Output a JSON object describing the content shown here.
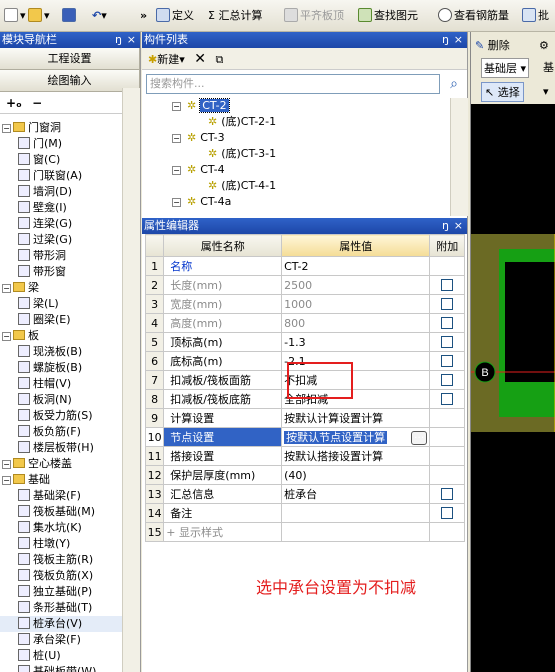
{
  "toolbar": {
    "define": "定义",
    "sum_calc": "Σ 汇总计算",
    "flat_top": "平齐板顶",
    "find_elem": "查找图元",
    "view_rebar": "查看钢筋量",
    "batch": "批"
  },
  "nav": {
    "title": "模块导航栏",
    "pin": "ŋ",
    "close": "×",
    "project_settings": "工程设置",
    "drawing_input": "绘图输入",
    "items": [
      {
        "label": "门窗洞",
        "type": "folder",
        "level": 0
      },
      {
        "label": "门(M)",
        "type": "leaf",
        "level": 1
      },
      {
        "label": "窗(C)",
        "type": "leaf",
        "level": 1
      },
      {
        "label": "门联窗(A)",
        "type": "leaf",
        "level": 1
      },
      {
        "label": "墙洞(D)",
        "type": "leaf",
        "level": 1
      },
      {
        "label": "壁龛(I)",
        "type": "leaf",
        "level": 1
      },
      {
        "label": "连梁(G)",
        "type": "leaf",
        "level": 1
      },
      {
        "label": "过梁(G)",
        "type": "leaf",
        "level": 1
      },
      {
        "label": "带形洞",
        "type": "leaf",
        "level": 1
      },
      {
        "label": "带形窗",
        "type": "leaf",
        "level": 1
      },
      {
        "label": "梁",
        "type": "folder",
        "level": 0
      },
      {
        "label": "梁(L)",
        "type": "leaf",
        "level": 1
      },
      {
        "label": "圈梁(E)",
        "type": "leaf",
        "level": 1
      },
      {
        "label": "板",
        "type": "folder",
        "level": 0
      },
      {
        "label": "现浇板(B)",
        "type": "leaf",
        "level": 1
      },
      {
        "label": "螺旋板(B)",
        "type": "leaf",
        "level": 1
      },
      {
        "label": "柱帽(V)",
        "type": "leaf",
        "level": 1
      },
      {
        "label": "板洞(N)",
        "type": "leaf",
        "level": 1
      },
      {
        "label": "板受力筋(S)",
        "type": "leaf",
        "level": 1
      },
      {
        "label": "板负筋(F)",
        "type": "leaf",
        "level": 1
      },
      {
        "label": "楼层板带(H)",
        "type": "leaf",
        "level": 1
      },
      {
        "label": "空心楼盖",
        "type": "folder",
        "level": 0
      },
      {
        "label": "基础",
        "type": "folder",
        "level": 0
      },
      {
        "label": "基础梁(F)",
        "type": "leaf",
        "level": 1
      },
      {
        "label": "筏板基础(M)",
        "type": "leaf",
        "level": 1
      },
      {
        "label": "集水坑(K)",
        "type": "leaf",
        "level": 1
      },
      {
        "label": "柱墩(Y)",
        "type": "leaf",
        "level": 1
      },
      {
        "label": "筏板主筋(R)",
        "type": "leaf",
        "level": 1
      },
      {
        "label": "筏板负筋(X)",
        "type": "leaf",
        "level": 1
      },
      {
        "label": "独立基础(P)",
        "type": "leaf",
        "level": 1
      },
      {
        "label": "条形基础(T)",
        "type": "leaf",
        "level": 1
      },
      {
        "label": "桩承台(V)",
        "type": "leaf",
        "level": 1,
        "selected": true
      },
      {
        "label": "承台梁(F)",
        "type": "leaf",
        "level": 1
      },
      {
        "label": "桩(U)",
        "type": "leaf",
        "level": 1
      },
      {
        "label": "基础板带(W)",
        "type": "leaf",
        "level": 1
      }
    ]
  },
  "comp": {
    "title": "构件列表",
    "new_label": "新建",
    "search_placeholder": "搜索构件...",
    "tree": [
      {
        "label": "CT-2",
        "level": 0,
        "selected": true
      },
      {
        "label": "(底)CT-2-1",
        "level": 1
      },
      {
        "label": "CT-3",
        "level": 0
      },
      {
        "label": "(底)CT-3-1",
        "level": 1
      },
      {
        "label": "CT-4",
        "level": 0
      },
      {
        "label": "(底)CT-4-1",
        "level": 1
      },
      {
        "label": "CT-4a",
        "level": 0
      }
    ]
  },
  "prop": {
    "title": "属性编辑器",
    "col_name": "属性名称",
    "col_value": "属性值",
    "col_add": "附加",
    "rows": [
      {
        "n": "1",
        "name": "名称",
        "value": "CT-2",
        "style": "blue",
        "cb": false
      },
      {
        "n": "2",
        "name": "长度(mm)",
        "value": "2500",
        "style": "gray",
        "cb": true
      },
      {
        "n": "3",
        "name": "宽度(mm)",
        "value": "1000",
        "style": "gray",
        "cb": true
      },
      {
        "n": "4",
        "name": "高度(mm)",
        "value": "800",
        "style": "gray",
        "cb": true
      },
      {
        "n": "5",
        "name": "顶标高(m)",
        "value": "-1.3",
        "style": "",
        "cb": true
      },
      {
        "n": "6",
        "name": "底标高(m)",
        "value": "-2.1",
        "style": "",
        "cb": true
      },
      {
        "n": "7",
        "name": "扣减板/筏板面筋",
        "value": "不扣减",
        "style": "",
        "cb": true
      },
      {
        "n": "8",
        "name": "扣减板/筏板底筋",
        "value": "全部扣减",
        "style": "",
        "cb": true
      },
      {
        "n": "9",
        "name": "计算设置",
        "value": "按默认计算设置计算",
        "style": "",
        "cb": false
      },
      {
        "n": "10",
        "name": "节点设置",
        "value": "按默认节点设置计算",
        "style": "",
        "cb": false,
        "selected": true
      },
      {
        "n": "11",
        "name": "搭接设置",
        "value": "按默认搭接设置计算",
        "style": "",
        "cb": false
      },
      {
        "n": "12",
        "name": "保护层厚度(mm)",
        "value": "(40)",
        "style": "",
        "cb": false
      },
      {
        "n": "13",
        "name": "汇总信息",
        "value": "桩承台",
        "style": "",
        "cb": true
      },
      {
        "n": "14",
        "name": "备注",
        "value": "",
        "style": "",
        "cb": true
      },
      {
        "n": "15",
        "name": "显示样式",
        "value": "",
        "style": "gray",
        "cb": false
      }
    ]
  },
  "annotation": "选中承台设置为不扣减",
  "right": {
    "delete": "删除",
    "layer": "基础层",
    "select": "选择",
    "marker": "B"
  },
  "colors": {
    "title_bar": "#1d47a8",
    "highlight": "#3163c5",
    "annotation": "#e41e1e"
  }
}
